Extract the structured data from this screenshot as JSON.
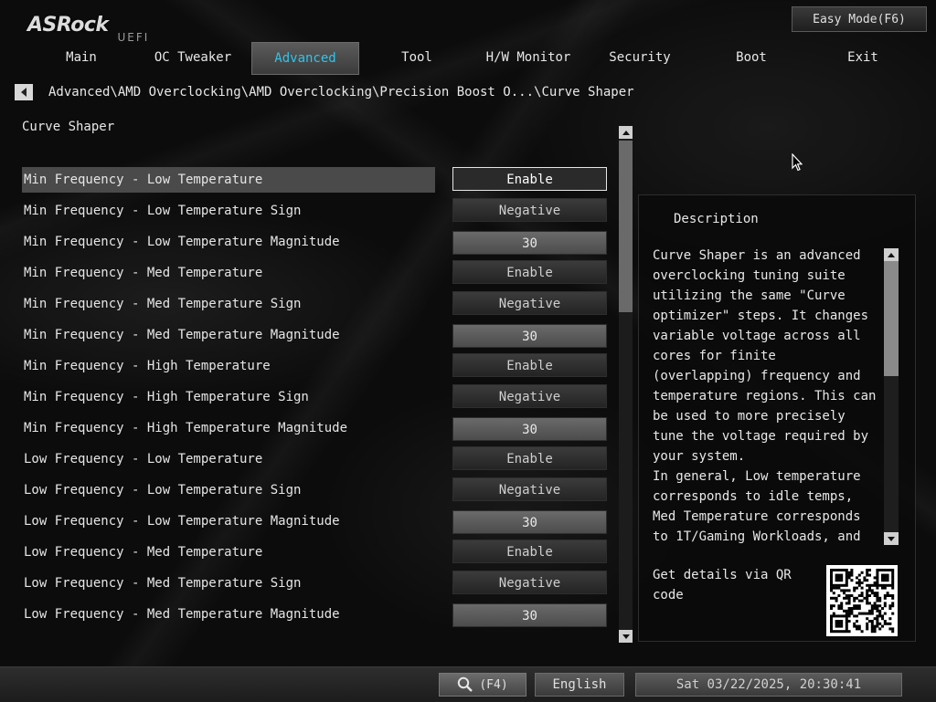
{
  "header": {
    "brand": "ASRock",
    "brand_suffix": "UEFI",
    "easy_mode_label": "Easy Mode(F6)"
  },
  "tabs": [
    {
      "label": "Main",
      "active": false
    },
    {
      "label": "OC Tweaker",
      "active": false
    },
    {
      "label": "Advanced",
      "active": true
    },
    {
      "label": "Tool",
      "active": false
    },
    {
      "label": "H/W Monitor",
      "active": false
    },
    {
      "label": "Security",
      "active": false
    },
    {
      "label": "Boot",
      "active": false
    },
    {
      "label": "Exit",
      "active": false
    }
  ],
  "breadcrumb": "Advanced\\AMD Overclocking\\AMD Overclocking\\Precision Boost O...\\Curve Shaper",
  "section_title": "Curve Shaper",
  "settings": [
    {
      "label": "Min Frequency - Low Temperature",
      "value": "Enable",
      "kind": "option",
      "selected": true
    },
    {
      "label": "Min Frequency - Low Temperature Sign",
      "value": "Negative",
      "kind": "option",
      "selected": false
    },
    {
      "label": "Min Frequency - Low Temperature Magnitude",
      "value": "30",
      "kind": "number",
      "selected": false
    },
    {
      "label": "Min Frequency - Med Temperature",
      "value": "Enable",
      "kind": "option",
      "selected": false
    },
    {
      "label": "Min Frequency - Med Temperature Sign",
      "value": "Negative",
      "kind": "option",
      "selected": false
    },
    {
      "label": "Min Frequency - Med Temperature Magnitude",
      "value": "30",
      "kind": "number",
      "selected": false
    },
    {
      "label": "Min Frequency - High Temperature",
      "value": "Enable",
      "kind": "option",
      "selected": false
    },
    {
      "label": "Min Frequency - High Temperature Sign",
      "value": "Negative",
      "kind": "option",
      "selected": false
    },
    {
      "label": "Min Frequency - High Temperature Magnitude",
      "value": "30",
      "kind": "number",
      "selected": false
    },
    {
      "label": "Low Frequency - Low Temperature",
      "value": "Enable",
      "kind": "option",
      "selected": false
    },
    {
      "label": "Low Frequency - Low Temperature Sign",
      "value": "Negative",
      "kind": "option",
      "selected": false
    },
    {
      "label": "Low Frequency - Low Temperature Magnitude",
      "value": "30",
      "kind": "number",
      "selected": false
    },
    {
      "label": "Low Frequency - Med Temperature",
      "value": "Enable",
      "kind": "option",
      "selected": false
    },
    {
      "label": "Low Frequency - Med Temperature Sign",
      "value": "Negative",
      "kind": "option",
      "selected": false
    },
    {
      "label": "Low Frequency - Med Temperature Magnitude",
      "value": "30",
      "kind": "number",
      "selected": false
    }
  ],
  "description": {
    "title": "Description",
    "text": "Curve Shaper is an advanced overclocking tuning suite utilizing the same \"Curve optimizer\" steps. It changes variable voltage across all cores for finite (overlapping) frequency and temperature regions. This can be used to more precisely tune the voltage required by your system.\nIn general, Low temperature corresponds to idle temps, Med Temperature corresponds to 1T/Gaming Workloads, and high",
    "qr_text": "Get details via QR code"
  },
  "footer": {
    "search_key": "(F4)",
    "language": "English",
    "datetime": "Sat 03/22/2025, 20:30:41"
  },
  "colors": {
    "accent": "#2ec5ec",
    "background": "#0c0c0c"
  },
  "icons": [
    "back-arrow-icon",
    "scroll-up-icon",
    "scroll-down-icon",
    "search-icon",
    "mouse-cursor-icon",
    "qr-code"
  ]
}
